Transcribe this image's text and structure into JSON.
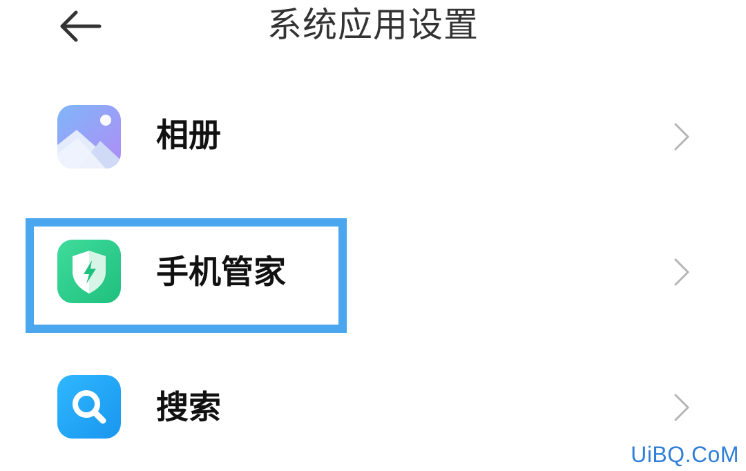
{
  "header": {
    "back_icon": "arrow-left-icon",
    "title": "系统应用设置"
  },
  "list": [
    {
      "label": "相册",
      "icon": "gallery-icon",
      "chevron": "chevron-right-icon"
    },
    {
      "label": "手机管家",
      "icon": "security-shield-icon",
      "chevron": "chevron-right-icon",
      "highlighted": true
    },
    {
      "label": "搜索",
      "icon": "search-icon",
      "chevron": "chevron-right-icon"
    }
  ],
  "watermark": "UiBQ.CoM",
  "colors": {
    "highlight_border": "#4aa6ee",
    "security_green": "#2ecf8d",
    "search_blue": "#1ea7f5",
    "gallery_purple": "#9b8cf5",
    "watermark_blue": "#2f7ed8",
    "chevron_gray": "#b5b5b5"
  }
}
